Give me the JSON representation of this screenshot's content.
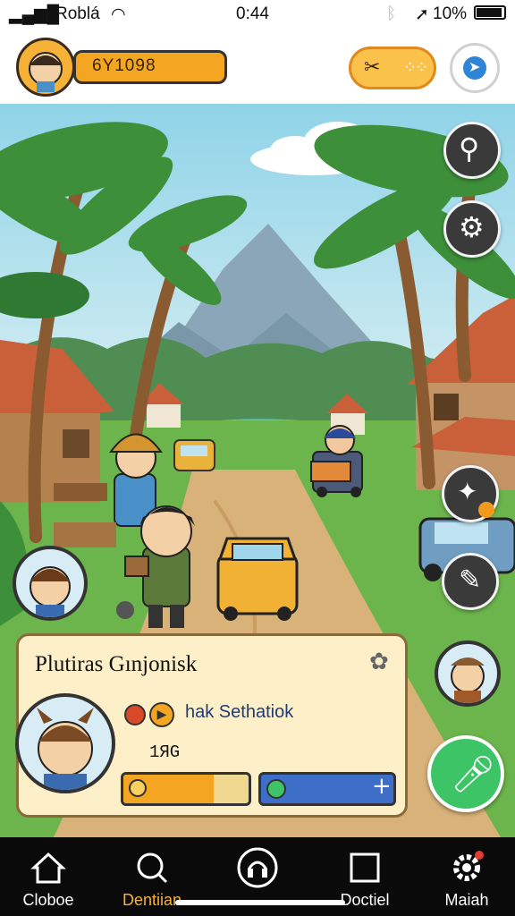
{
  "status_bar": {
    "carrier": "Roblá",
    "time": "0:44",
    "battery": "10%"
  },
  "header": {
    "currency_value": "6Y1098",
    "icons": [
      "player-avatar-icon",
      "tools-icon",
      "menu-dots-icon",
      "location-arrow-icon"
    ]
  },
  "side_buttons": [
    "magnifier-icon",
    "settings-gear-icon",
    "boost-icon",
    "map-icon"
  ],
  "dialog": {
    "title": "Plutiras Gınjonisk",
    "subtitle": "hak Sethatiok",
    "count": "1ЯG",
    "progress": 0.72
  },
  "nav": {
    "items": [
      {
        "label": "Cloboe",
        "icon": "home-icon",
        "active": false
      },
      {
        "label": "Dentiian",
        "icon": "search-icon",
        "active": true
      },
      {
        "label": "",
        "icon": "headphones-icon",
        "active": false
      },
      {
        "label": "Doctiel",
        "icon": "square-icon",
        "active": false
      },
      {
        "label": "Maiah",
        "icon": "gear-icon",
        "active": false
      }
    ]
  },
  "colors": {
    "accent": "#f4a622",
    "active_nav": "#f5b236",
    "action_green": "#3cc466",
    "card_bg": "#fdf0c9"
  }
}
